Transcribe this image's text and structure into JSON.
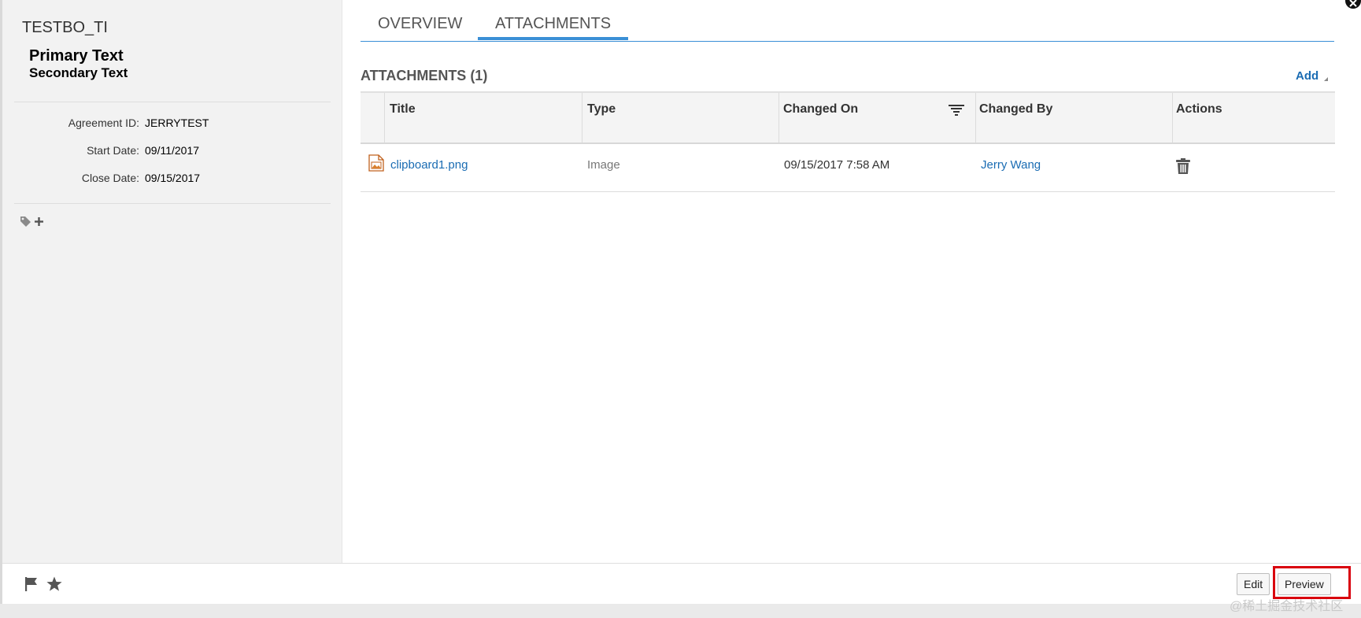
{
  "header": {
    "object_title": "TESTBO_TI",
    "primary_text": "Primary Text",
    "secondary_text": "Secondary Text"
  },
  "fields": [
    {
      "label": "Agreement ID:",
      "value": "JERRYTEST"
    },
    {
      "label": "Start Date:",
      "value": "09/11/2017"
    },
    {
      "label": "Close Date:",
      "value": "09/15/2017"
    }
  ],
  "tabs": [
    {
      "label": "OVERVIEW",
      "active": false
    },
    {
      "label": "ATTACHMENTS",
      "active": true
    }
  ],
  "attachments": {
    "title": "ATTACHMENTS (1)",
    "add_label": "Add",
    "columns": [
      "Title",
      "Type",
      "Changed On",
      "Changed By",
      "Actions"
    ],
    "rows": [
      {
        "title": "clipboard1.png",
        "type": "Image",
        "changed_on": "09/15/2017 7:58 AM",
        "changed_by": "Jerry Wang"
      }
    ]
  },
  "footer": {
    "edit_label": "Edit",
    "preview_label": "Preview"
  },
  "watermark": "@稀土掘金技术社区",
  "icons": {
    "tag": "tag-icon",
    "add": "plus-icon",
    "file": "image-file-icon",
    "delete": "trash-icon",
    "sort": "sort-filter-icon",
    "flag": "flag-icon",
    "favorite": "star-icon",
    "close": "close-icon"
  },
  "colors": {
    "accent": "#3a8fd6",
    "link": "#1a6cb3",
    "highlight": "#d9000d",
    "left_panel_bg": "#f2f2f2"
  }
}
